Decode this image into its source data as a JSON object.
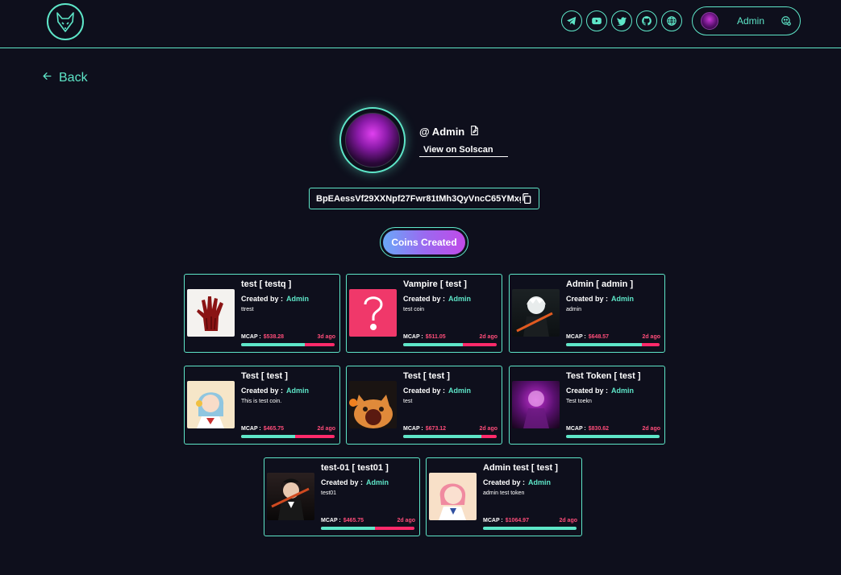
{
  "header": {
    "user": {
      "name": "Admin"
    },
    "socials": [
      "telegram-icon",
      "youtube-icon",
      "twitter-icon",
      "github-icon",
      "globe-icon"
    ]
  },
  "nav": {
    "back_label": "Back"
  },
  "profile": {
    "name": "@ Admin",
    "solscan_label": "View on Solscan",
    "address": "BpEAessVf29XXNpf27Fwr81tMh3QyVncC65YMxg..."
  },
  "tabs": {
    "coins_created_label": "Coins Created"
  },
  "coins": [
    {
      "title": "test [ testq ]",
      "created_by_label": "Created by :",
      "creator": "Admin",
      "description": "ttrest",
      "mcap_label": "MCAP :",
      "mcap": "$538.28",
      "age": "3d ago",
      "progress": 0.68
    },
    {
      "title": "Vampire [ test ]",
      "created_by_label": "Created by :",
      "creator": "Admin",
      "description": "test coin",
      "mcap_label": "MCAP :",
      "mcap": "$511.05",
      "age": "2d ago",
      "progress": 0.64
    },
    {
      "title": "Admin [ admin ]",
      "created_by_label": "Created by :",
      "creator": "Admin",
      "description": "admin",
      "mcap_label": "MCAP :",
      "mcap": "$648.57",
      "age": "2d ago",
      "progress": 0.81
    },
    {
      "title": "Test [ test ]",
      "created_by_label": "Created by :",
      "creator": "Admin",
      "description": "This is test coin.",
      "mcap_label": "MCAP :",
      "mcap": "$465.75",
      "age": "2d ago",
      "progress": 0.58
    },
    {
      "title": "Test [ test ]",
      "created_by_label": "Created by :",
      "creator": "Admin",
      "description": "test",
      "mcap_label": "MCAP :",
      "mcap": "$673.12",
      "age": "2d ago",
      "progress": 0.84
    },
    {
      "title": "Test Token [ test ]",
      "created_by_label": "Created by :",
      "creator": "Admin",
      "description": "Test toekn",
      "mcap_label": "MCAP :",
      "mcap": "$830.62",
      "age": "2d ago",
      "progress": 1.0
    },
    {
      "title": "test-01 [ test01 ]",
      "created_by_label": "Created by :",
      "creator": "Admin",
      "description": "test01",
      "mcap_label": "MCAP :",
      "mcap": "$465.75",
      "age": "2d ago",
      "progress": 0.58
    },
    {
      "title": "Admin test [ test ]",
      "created_by_label": "Created by :",
      "creator": "Admin",
      "description": "admin test token",
      "mcap_label": "MCAP :",
      "mcap": "$1064.97",
      "age": "2d ago",
      "progress": 1.0
    }
  ],
  "colors": {
    "accent": "#5ee6c8",
    "background": "#0e0f1c",
    "mcap": "#ff4d7a",
    "bar_remaining": "#ff2a6a"
  }
}
